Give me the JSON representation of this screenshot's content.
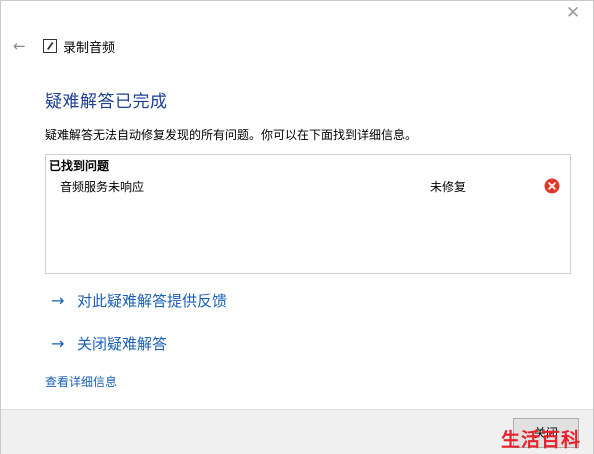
{
  "window": {
    "app_title": "录制音频",
    "close_icon": "close-icon",
    "back_icon": "back-arrow-icon",
    "app_icon": "microphone-app-icon"
  },
  "main": {
    "heading": "疑难解答已完成",
    "description": "疑难解答无法自动修复发现的所有问题。你可以在下面找到详细信息。",
    "results": {
      "header": "已找到问题",
      "rows": [
        {
          "problem": "音频服务未响应",
          "status": "未修复",
          "status_icon": "error-icon",
          "status_color": "#e0392b"
        }
      ]
    },
    "links": {
      "feedback": "对此疑难解答提供反馈",
      "close": "关闭疑难解答",
      "details": "查看详细信息"
    }
  },
  "footer": {
    "button_label": "关闭"
  },
  "watermark": {
    "text": "生活百科",
    "color": "#e8202a"
  },
  "colors": {
    "heading": "#1c3f94",
    "link": "#1a5fb4"
  }
}
